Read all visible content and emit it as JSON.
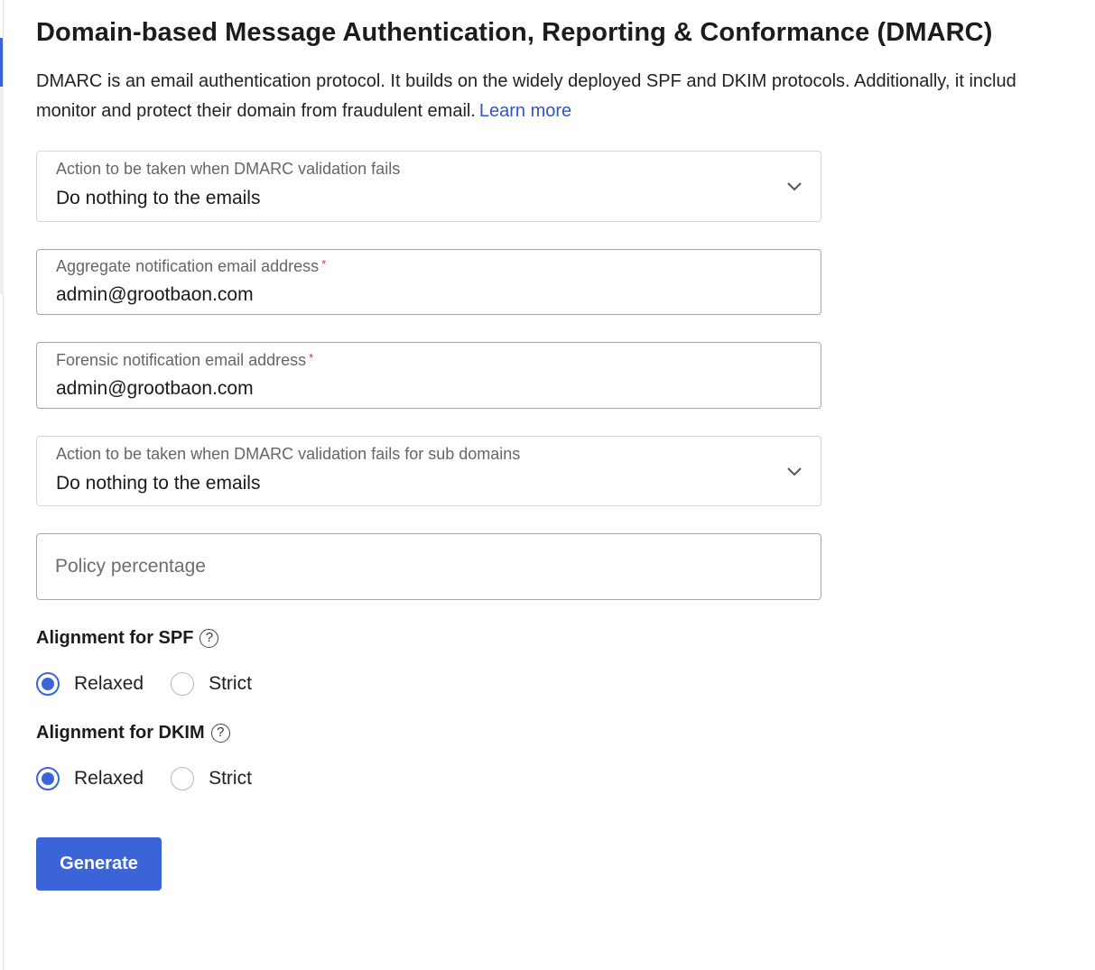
{
  "page": {
    "title": "Domain-based Message Authentication, Reporting & Conformance (DMARC)",
    "description": "DMARC is an email authentication protocol. It builds on the widely deployed SPF and DKIM protocols. Additionally, it includes reporting functions that allow senders and receivers to improve and monitor and protect their domain from fraudulent email.",
    "description_line1": "DMARC is an email authentication protocol. It builds on the widely deployed SPF and DKIM protocols. Additionally, it includ",
    "description_line2": "monitor and protect their domain from fraudulent email.",
    "learn_more": "Learn more"
  },
  "form": {
    "dmarc_action": {
      "label": "Action to be taken when DMARC validation fails",
      "value": "Do nothing to the emails"
    },
    "aggregate_email": {
      "label": "Aggregate notification email address",
      "required_mark": "*",
      "value": "admin@grootbaon.com"
    },
    "forensic_email": {
      "label": "Forensic notification email address",
      "required_mark": "*",
      "value": "admin@grootbaon.com"
    },
    "subdomain_action": {
      "label": "Action to be taken when DMARC validation fails for sub domains",
      "value": "Do nothing to the emails"
    },
    "policy_percentage": {
      "placeholder": "Policy percentage",
      "value": ""
    },
    "spf_alignment": {
      "title": "Alignment for SPF",
      "help": "?",
      "options": [
        "Relaxed",
        "Strict"
      ],
      "selected": "Relaxed"
    },
    "dkim_alignment": {
      "title": "Alignment for DKIM",
      "help": "?",
      "options": [
        "Relaxed",
        "Strict"
      ],
      "selected": "Relaxed"
    },
    "generate_label": "Generate"
  },
  "colors": {
    "accent": "#3a64d8",
    "link": "#2f55c9",
    "required": "#d93838"
  }
}
